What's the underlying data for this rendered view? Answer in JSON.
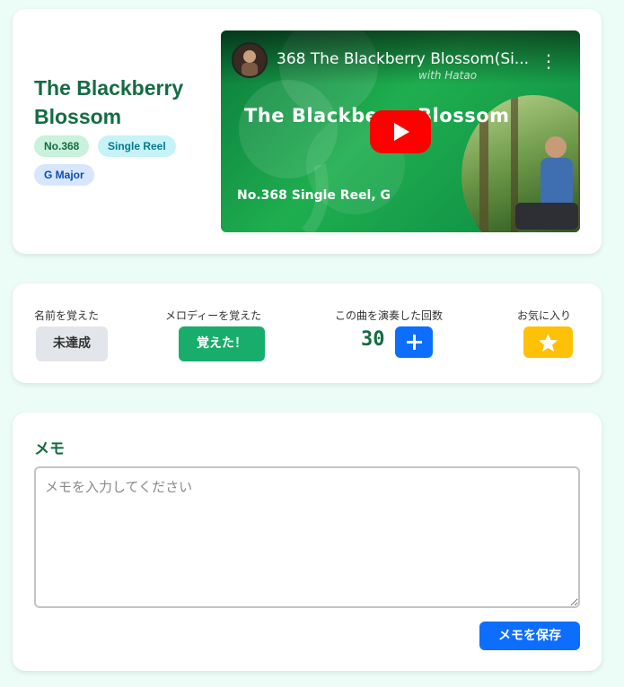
{
  "tune": {
    "title": "The Blackberry Blossom",
    "badges": {
      "number": "No.368",
      "type": "Single Reel",
      "key": "G Major"
    }
  },
  "video": {
    "title": "368 The Blackberry Blossom(Si...",
    "overlay_brand": "with Hatao",
    "overlay_heading": "The Blackberry Blossom",
    "overlay_footer": "No.368 Single Reel, G",
    "play_icon": "youtube-play-icon",
    "menu_icon": "more-vert-icon"
  },
  "status": {
    "name_label": "名前を覚えた",
    "name_button": "未達成",
    "melody_label": "メロディーを覚えた",
    "melody_button": "覚えた！",
    "play_count_label": "この曲を演奏した回数",
    "play_count": "30",
    "plus_icon": "plus-icon",
    "favorite_label": "お気に入り",
    "favorite_icon": "star-icon"
  },
  "memo": {
    "heading": "メモ",
    "placeholder": "メモを入力してください",
    "value": "",
    "save_button": "メモを保存"
  },
  "colors": {
    "page_bg": "#ecfdf7",
    "accent_green": "#146c43",
    "button_green": "#19ad6b",
    "button_blue": "#0d6efd",
    "favorite_yellow": "#ffc107",
    "youtube_red": "#ff0000"
  }
}
